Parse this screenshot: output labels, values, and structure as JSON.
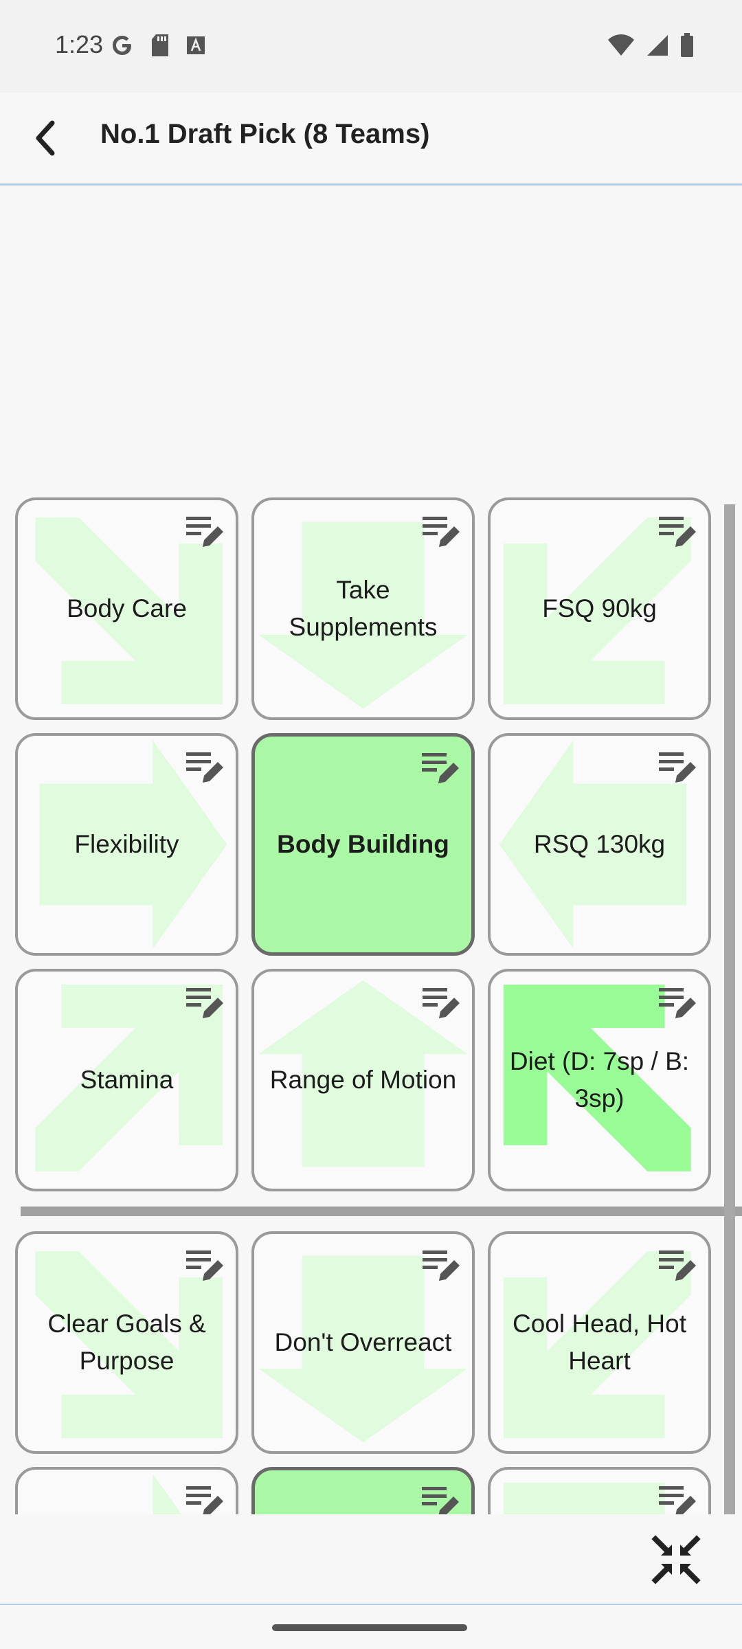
{
  "status_bar": {
    "time": "1:23",
    "left_icons": [
      "google-icon",
      "sd-card-icon",
      "font-icon"
    ],
    "right_icons": [
      "wifi-icon",
      "signal-icon",
      "battery-icon"
    ]
  },
  "app_bar": {
    "title": "No.1 Draft Pick (8 Teams)",
    "back_icon": "back-arrow-icon"
  },
  "colors": {
    "arrow_light": "#e0fbdd",
    "arrow_strong": "#98fb95",
    "active_cell": "#aaf8a6",
    "border": "#9a9a9a"
  },
  "grid_top": [
    {
      "label": "Body Care",
      "arrow": "down-right",
      "active": false
    },
    {
      "label": "Take Supplements",
      "arrow": "down",
      "active": false
    },
    {
      "label": "FSQ 90kg",
      "arrow": "down-left",
      "active": false
    },
    {
      "label": "Flexibility",
      "arrow": "right",
      "active": false
    },
    {
      "label": "Body Building",
      "arrow": "none",
      "active": true
    },
    {
      "label": "RSQ 130kg",
      "arrow": "left",
      "active": false
    },
    {
      "label": "Stamina",
      "arrow": "up-right",
      "active": false
    },
    {
      "label": "Range of Motion",
      "arrow": "up",
      "active": false
    },
    {
      "label": "Diet (D: 7sp / B: 3sp)",
      "arrow": "up-left",
      "active": false,
      "strong": true
    }
  ],
  "grid_bottom": [
    {
      "label": "Clear Goals & Purpose",
      "arrow": "down-right",
      "active": false
    },
    {
      "label": "Don't Overreact",
      "arrow": "down",
      "active": false
    },
    {
      "label": "Cool Head, Hot Heart",
      "arrow": "down-left",
      "active": false
    },
    {
      "label": "",
      "arrow": "right",
      "active": false
    },
    {
      "label": "",
      "arrow": "none",
      "active": true
    },
    {
      "label": "",
      "arrow": "up-left",
      "active": false
    }
  ],
  "bottom_bar": {
    "collapse_icon": "collapse-icon"
  }
}
